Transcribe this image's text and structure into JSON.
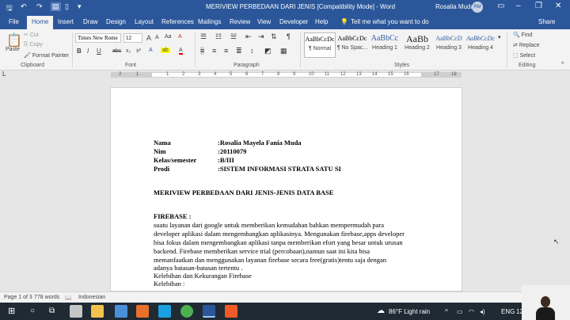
{
  "titlebar": {
    "title": "MERIVIEW PERBEDAAN DARI JENIS [Compatibility Mode] - Word",
    "user": "Rosalia Muda",
    "avatar_initials": "RM",
    "quick_access": [
      "save-icon",
      "undo-icon",
      "redo-icon",
      "layout-icon",
      "page-icon",
      "customize-icon"
    ]
  },
  "tabs": [
    "File",
    "Home",
    "Insert",
    "Draw",
    "Design",
    "Layout",
    "References",
    "Mailings",
    "Review",
    "View",
    "Developer",
    "Help"
  ],
  "tell_me": "Tell me what you want to do",
  "share": "Share",
  "ribbon": {
    "clipboard": {
      "paste": "Paste",
      "cut": "Cut",
      "copy": "Copy",
      "format_painter": "Format Painter",
      "label": "Clipboard"
    },
    "font": {
      "name": "Times New Rome",
      "size": "12",
      "label": "Font",
      "bold": "B",
      "italic": "I",
      "underline": "U",
      "strike": "abc",
      "sub": "x₂",
      "sup": "x²",
      "grow": "A",
      "shrink": "A",
      "case": "Aa",
      "clear": "A"
    },
    "paragraph": {
      "label": "Paragraph"
    },
    "styles": {
      "label": "Styles",
      "items": [
        {
          "preview": "AaBbCcDc",
          "name": "¶ Normal"
        },
        {
          "preview": "AaBbCcDc",
          "name": "¶ No Spac..."
        },
        {
          "preview": "AaBbCc",
          "name": "Heading 1"
        },
        {
          "preview": "AaBb",
          "name": "Heading 2"
        },
        {
          "preview": "AaBbCcD",
          "name": "Heading 3"
        },
        {
          "preview": "AaBbCcDc",
          "name": "Heading 4"
        }
      ]
    },
    "editing": {
      "find": "Find",
      "replace": "Replace",
      "select": "Select",
      "label": "Editing"
    }
  },
  "ruler": {
    "numbers": [
      "2",
      "1",
      "1",
      "2",
      "3",
      "4",
      "5",
      "6",
      "7",
      "8",
      "9",
      "10",
      "11",
      "12",
      "13",
      "14",
      "15",
      "16",
      "17",
      "18"
    ]
  },
  "document": {
    "fields": [
      {
        "label": "Nama",
        "value": ":Rosalia Mayela Fania Muda"
      },
      {
        "label": "Nim",
        "value": ":20110079"
      },
      {
        "label": "Kelas/semester",
        "value": ":B/III"
      },
      {
        "label": "Prodi",
        "value": ":SISTEM INFORMASI STRATA SATU SI"
      }
    ],
    "heading": "MERIVIEW PERBEDAAN DARI JENIS-JENIS DATA BASE",
    "section": "FIREBASE :",
    "body": [
      " suatu layanan dari google untuk memberikan kemudahan bahkan mempermudah para",
      "developer aplikasi dalam mengembangkan aplikasinya. Mengunakan firebase,apps developer",
      "bisa fokus dalam mengembangkan aplikasi tanpa memberikan efort yang besar untuk urusan",
      "backend. Firebase memberikan service trial (percobaan),namun saat ini kita bisa",
      "memanfaatkan dan menggunakan layanan firebase secara free(gratis)tentu saja dengan",
      "adanya batasan-batasan tertentu .",
      "Kelebihan dan Kekurangan Firebase",
      "Kelebihan :"
    ]
  },
  "status": {
    "page": "Page 1 of 3",
    "words": "778 words",
    "language": "Indonesian"
  },
  "taskbar": {
    "weather": "86°F  Light rain",
    "lang": "ENG",
    "clock": "12"
  }
}
